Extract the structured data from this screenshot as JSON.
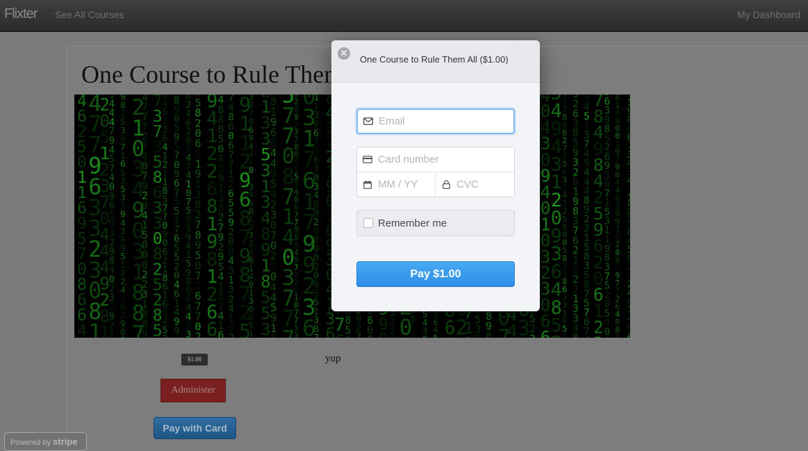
{
  "nav": {
    "brand": "Flixter",
    "see_all_courses": "See All Courses",
    "my_dashboard": "My Dashboard"
  },
  "course": {
    "title": "One Course to Rule Them All",
    "hero_image_icon": "matrix-digital-rain-image",
    "price_badge": "$1.00",
    "description": "yup",
    "administer_label": "Administer",
    "pay_with_card_label": "Pay with Card"
  },
  "stripe_badge": {
    "prefix": "Powered by",
    "brand": "stripe"
  },
  "checkout_modal": {
    "title": "One Course to Rule Them All ($1.00)",
    "close_icon": "close-circle-icon",
    "email_placeholder": "Email",
    "email_icon": "envelope-icon",
    "card_number_placeholder": "Card number",
    "card_icon": "credit-card-icon",
    "expiry_placeholder": "MM / YY",
    "expiry_icon": "calendar-icon",
    "cvc_placeholder": "CVC",
    "cvc_icon": "lock-icon",
    "remember_me_label": "Remember me",
    "remember_me_checked": false,
    "pay_button_label": "Pay $1.00",
    "accent_color": "#3a9aee"
  }
}
